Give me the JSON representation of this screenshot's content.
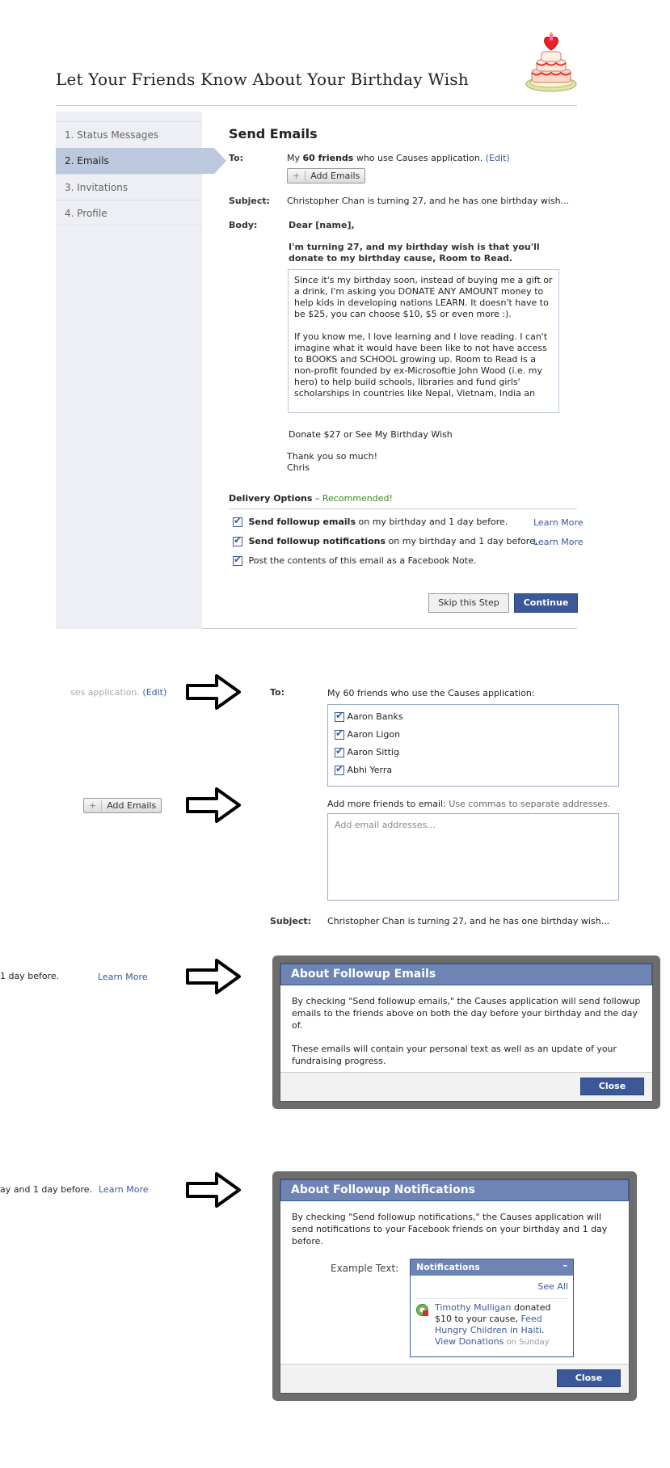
{
  "page": {
    "title": "Let Your Friends Know About Your Birthday Wish"
  },
  "sidebar": {
    "items": [
      {
        "label": "1. Status Messages"
      },
      {
        "label": "2. Emails"
      },
      {
        "label": "3. Invitations"
      },
      {
        "label": "4. Profile"
      }
    ]
  },
  "send_emails": {
    "title": "Send Emails",
    "to_label": "To:",
    "to_prefix": "My ",
    "to_count": "60 friends",
    "to_suffix": " who use Causes application.",
    "edit_link": "(Edit)",
    "add_emails_button": "Add Emails",
    "subject_label": "Subject:",
    "subject_value": "Christopher Chan is turning 27, and he has one birthday wish...",
    "body_label": "Body:",
    "body_greeting": "Dear [name],",
    "body_intro": "I'm turning 27, and my birthday wish is that you'll donate to my birthday cause, Room to Read.",
    "body_text_p1": "Since it's my birthday soon, instead of buying me a gift or a drink, I'm asking you DONATE ANY AMOUNT money to help kids in developing nations LEARN. It doesn't have to be $25, you can choose $10, $5 or even more :).",
    "body_text_p2": "If you know me, I love learning and I love reading. I can't imagine what it would have been like to not have access to BOOKS and SCHOOL growing up. Room to Read is a non-profit founded by ex-Microsoftie John Wood (i.e. my hero) to help build schools, libraries and fund girls' scholarships in countries like Nepal, Vietnam, India an",
    "body_donate": "Donate $27 or See My Birthday Wish",
    "body_thanks": "Thank you so much!",
    "body_sign": "Chris"
  },
  "delivery": {
    "title": "Delivery Options",
    "dash": " – ",
    "recommended": "Recommended!",
    "opt1_bold": "Send followup emails",
    "opt1_rest": " on my birthday and 1 day before.",
    "opt2_bold": "Send followup notifications",
    "opt2_rest": " on my birthday and 1 day before.",
    "opt3": "Post the contents of this email as a Facebook Note.",
    "learn_more": "Learn More",
    "skip_button": "Skip this Step",
    "continue_button": "Continue"
  },
  "detail_to": {
    "snippet_text": "ses application. ",
    "snippet_edit": "(Edit)",
    "to_label": "To:",
    "list_heading": "My 60 friends who use the Causes application:",
    "friends": [
      "Aaron Banks",
      "Aaron Ligon",
      "Aaron Sittig",
      "Abhi Yerra"
    ]
  },
  "detail_add": {
    "snippet_button": "Add Emails",
    "add_more_label": "Add more friends to email:",
    "add_more_hint": " Use commas to separate addresses.",
    "placeholder": "Add email addresses...",
    "subject_label": "Subject:",
    "subject_value": "Christopher Chan is turning 27, and he has one birthday wish..."
  },
  "dialog_emails": {
    "snippet_text": " 1 day before.",
    "snippet_link": "Learn More",
    "title": "About Followup Emails",
    "p1": "By checking \"Send followup emails,\" the Causes application will send followup emails to the friends above on both the day before your birthday and the day of.",
    "p2": "These emails will contain your personal text as well as an update of your fundraising progress.",
    "close": "Close"
  },
  "dialog_notifications": {
    "snippet_text": "ay and 1 day before.",
    "snippet_link": "Learn More",
    "title": "About Followup Notifications",
    "p1": "By checking \"Send followup notifications,\" the Causes application will send notifications to your Facebook friends on your birthday and 1 day before.",
    "example_label": "Example Text:",
    "notif_header": "Notifications",
    "notif_minimize": "–",
    "see_all": "See All",
    "notif_name": "Timothy Mulligan",
    "notif_text1": " donated $10 to your cause, ",
    "notif_cause": "Feed Hungry Children in Haiti",
    "notif_dot": ". ",
    "notif_view": "View Donations",
    "notif_time": " on Sunday",
    "close": "Close"
  }
}
